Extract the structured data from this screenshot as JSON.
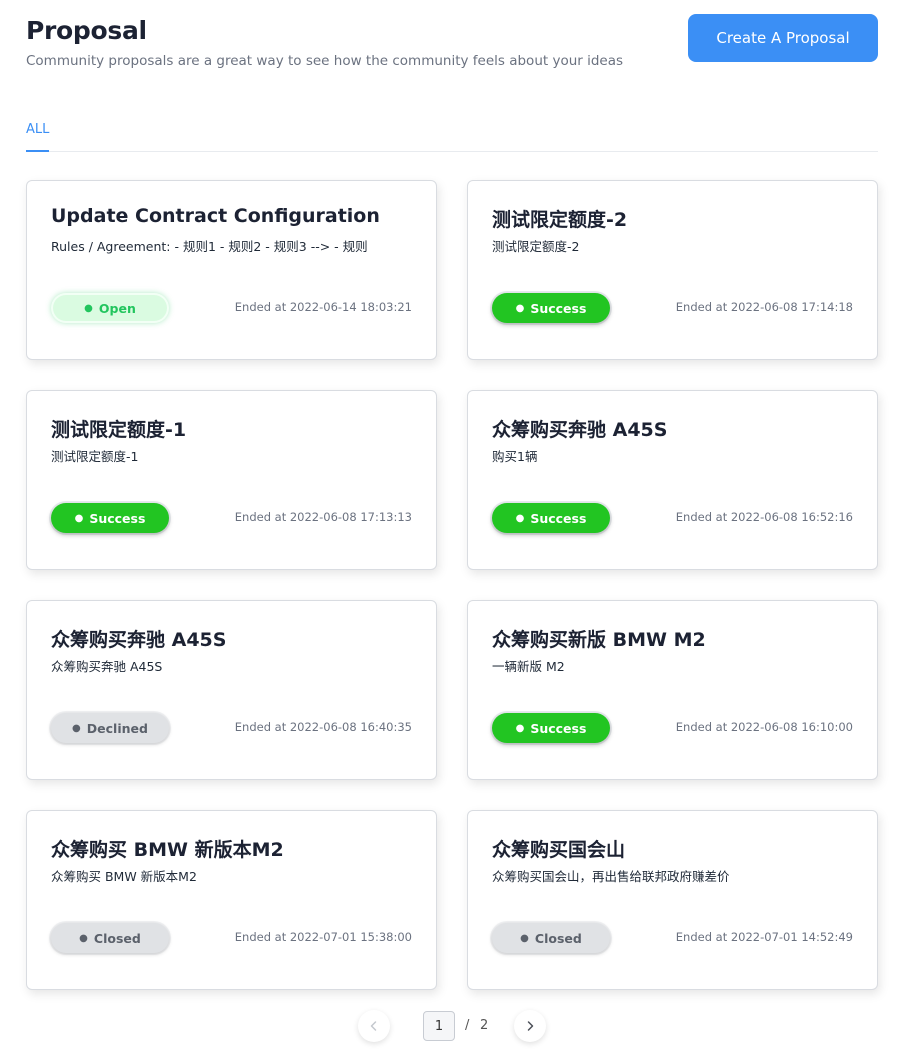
{
  "header": {
    "title": "Proposal",
    "subtitle": "Community proposals are a great way to see how the community feels about your ideas",
    "create_button": "Create A Proposal"
  },
  "tabs": [
    {
      "label": "ALL",
      "active": true
    }
  ],
  "proposals": [
    {
      "title": "Update Contract Configuration",
      "description": "Rules / Agreement: - 规则1 - 规则2 - 规则3 --> - 规则",
      "status": "Open",
      "date": "Ended at 2022-06-14 18:03:21"
    },
    {
      "title": "测试限定额度-2",
      "description": "测试限定额度-2",
      "status": "Success",
      "date": "Ended at 2022-06-08 17:14:18"
    },
    {
      "title": "测试限定额度-1",
      "description": "测试限定额度-1",
      "status": "Success",
      "date": "Ended at 2022-06-08 17:13:13"
    },
    {
      "title": "众筹购买奔驰 A45S",
      "description": "购买1辆",
      "status": "Success",
      "date": "Ended at 2022-06-08 16:52:16"
    },
    {
      "title": "众筹购买奔驰 A45S",
      "description": "众筹购买奔驰 A45S",
      "status": "Declined",
      "date": "Ended at 2022-06-08 16:40:35"
    },
    {
      "title": "众筹购买新版 BMW M2",
      "description": "一辆新版 M2",
      "status": "Success",
      "date": "Ended at 2022-06-08 16:10:00"
    },
    {
      "title": "众筹购买 BMW 新版本M2",
      "description": "众筹购买 BMW 新版本M2",
      "status": "Closed",
      "date": "Ended at 2022-07-01 15:38:00"
    },
    {
      "title": "众筹购买国会山",
      "description": "众筹购买国会山，再出售给联邦政府赚差价",
      "status": "Closed",
      "date": "Ended at 2022-07-01 14:52:49"
    }
  ],
  "pagination": {
    "current": "1",
    "separator": "/",
    "total": "2"
  },
  "status_dot": "●",
  "colors": {
    "accent": "#3b8ff5",
    "success": "#22c522",
    "open": "#22c55e",
    "muted": "#e0e2e5"
  }
}
